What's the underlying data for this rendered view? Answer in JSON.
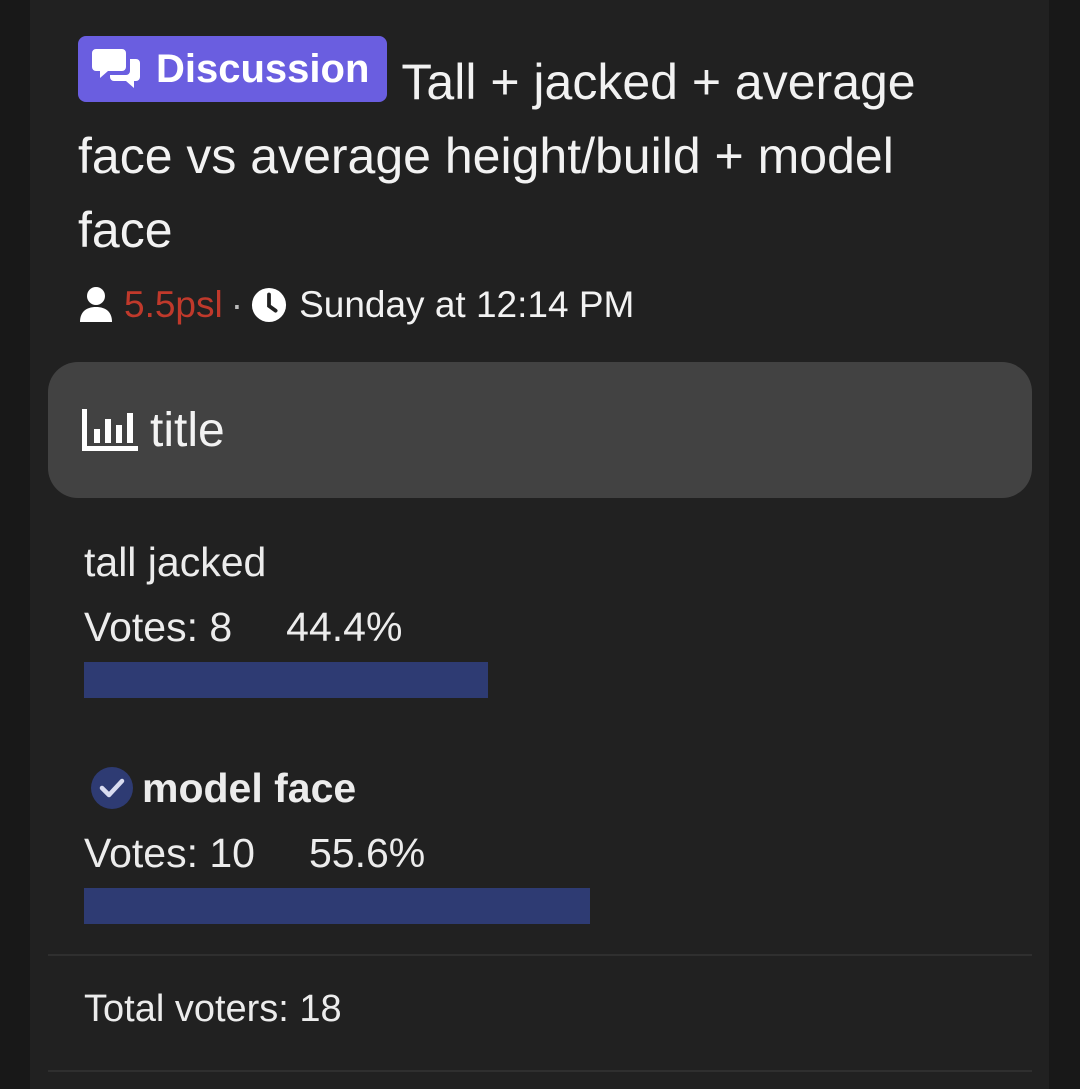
{
  "thread": {
    "prefix": "Discussion",
    "prefix_color": "#6a5ee0",
    "prefix_icon": "chat-bubbles-icon",
    "title": "Tall + jacked + average face vs average height/build + model face",
    "author": "5.5psl",
    "author_color": "#c0392b",
    "separator": "·",
    "date": "Sunday at 12:14 PM"
  },
  "poll": {
    "title": "title",
    "options": [
      {
        "label": "tall jacked",
        "votes_label": "Votes: 8",
        "percent_label": "44.4%",
        "percent": 44.4,
        "voted": false
      },
      {
        "label": "model face",
        "votes_label": "Votes: 10",
        "percent_label": "55.6%",
        "percent": 55.6,
        "voted": true
      }
    ],
    "bar_color": "#2e3b73",
    "total_voters": "Total voters: 18"
  }
}
